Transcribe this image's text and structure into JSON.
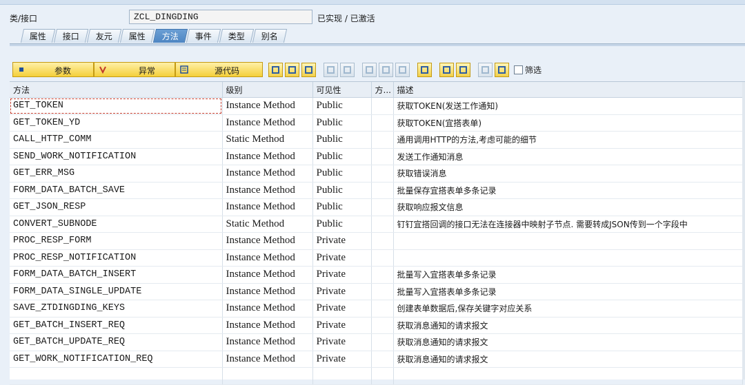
{
  "header": {
    "label": "类/接口",
    "class_name": "ZCL_DINGDING",
    "status": "已实现 / 已激活"
  },
  "tabs": [
    {
      "label": "属性",
      "active": false
    },
    {
      "label": "接口",
      "active": false
    },
    {
      "label": "友元",
      "active": false
    },
    {
      "label": "属性",
      "active": false
    },
    {
      "label": "方法",
      "active": true
    },
    {
      "label": "事件",
      "active": false
    },
    {
      "label": "类型",
      "active": false
    },
    {
      "label": "别名",
      "active": false
    }
  ],
  "toolbar": {
    "params_label": "参数",
    "exceptions_label": "异常",
    "source_label": "源代码",
    "filter_label": "筛选",
    "filter_checked": false
  },
  "table": {
    "columns": [
      "方法",
      "级别",
      "可见性",
      "方...",
      "描述"
    ],
    "rows": [
      {
        "method": "GET_TOKEN",
        "level": "Instance Method",
        "visibility": "Public",
        "flag": "",
        "description": "获取TOKEN(发送工作通知)"
      },
      {
        "method": "GET_TOKEN_YD",
        "level": "Instance Method",
        "visibility": "Public",
        "flag": "",
        "description": "获取TOKEN(宜搭表单)"
      },
      {
        "method": "CALL_HTTP_COMM",
        "level": "Static Method",
        "visibility": "Public",
        "flag": "",
        "description": "通用调用HTTP的方法,考虑可能的细节"
      },
      {
        "method": "SEND_WORK_NOTIFICATION",
        "level": "Instance Method",
        "visibility": "Public",
        "flag": "",
        "description": "发送工作通知消息"
      },
      {
        "method": "GET_ERR_MSG",
        "level": "Instance Method",
        "visibility": "Public",
        "flag": "",
        "description": "获取错误消息"
      },
      {
        "method": "FORM_DATA_BATCH_SAVE",
        "level": "Instance Method",
        "visibility": "Public",
        "flag": "",
        "description": "批量保存宜搭表单多条记录"
      },
      {
        "method": "GET_JSON_RESP",
        "level": "Instance Method",
        "visibility": "Public",
        "flag": "",
        "description": "获取响应报文信息"
      },
      {
        "method": "CONVERT_SUBNODE",
        "level": "Static Method",
        "visibility": "Public",
        "flag": "",
        "description": "钉钉宜搭回调的接口无法在连接器中映射子节点. 需要转成JSON传到一个字段中"
      },
      {
        "method": "PROC_RESP_FORM",
        "level": "Instance Method",
        "visibility": "Private",
        "flag": "",
        "description": ""
      },
      {
        "method": "PROC_RESP_NOTIFICATION",
        "level": "Instance Method",
        "visibility": "Private",
        "flag": "",
        "description": ""
      },
      {
        "method": "FORM_DATA_BATCH_INSERT",
        "level": "Instance Method",
        "visibility": "Private",
        "flag": "",
        "description": "批量写入宜搭表单多条记录"
      },
      {
        "method": "FORM_DATA_SINGLE_UPDATE",
        "level": "Instance Method",
        "visibility": "Private",
        "flag": "",
        "description": "批量写入宜搭表单多条记录"
      },
      {
        "method": "SAVE_ZTDINGDING_KEYS",
        "level": "Instance Method",
        "visibility": "Private",
        "flag": "",
        "description": "创建表单数据后,保存关键字对应关系"
      },
      {
        "method": "GET_BATCH_INSERT_REQ",
        "level": "Instance Method",
        "visibility": "Private",
        "flag": "",
        "description": "获取消息通知的请求报文"
      },
      {
        "method": "GET_BATCH_UPDATE_REQ",
        "level": "Instance Method",
        "visibility": "Private",
        "flag": "",
        "description": "获取消息通知的请求报文"
      },
      {
        "method": "GET_WORK_NOTIFICATION_REQ",
        "level": "Instance Method",
        "visibility": "Private",
        "flag": "",
        "description": "获取消息通知的请求报文"
      }
    ]
  }
}
